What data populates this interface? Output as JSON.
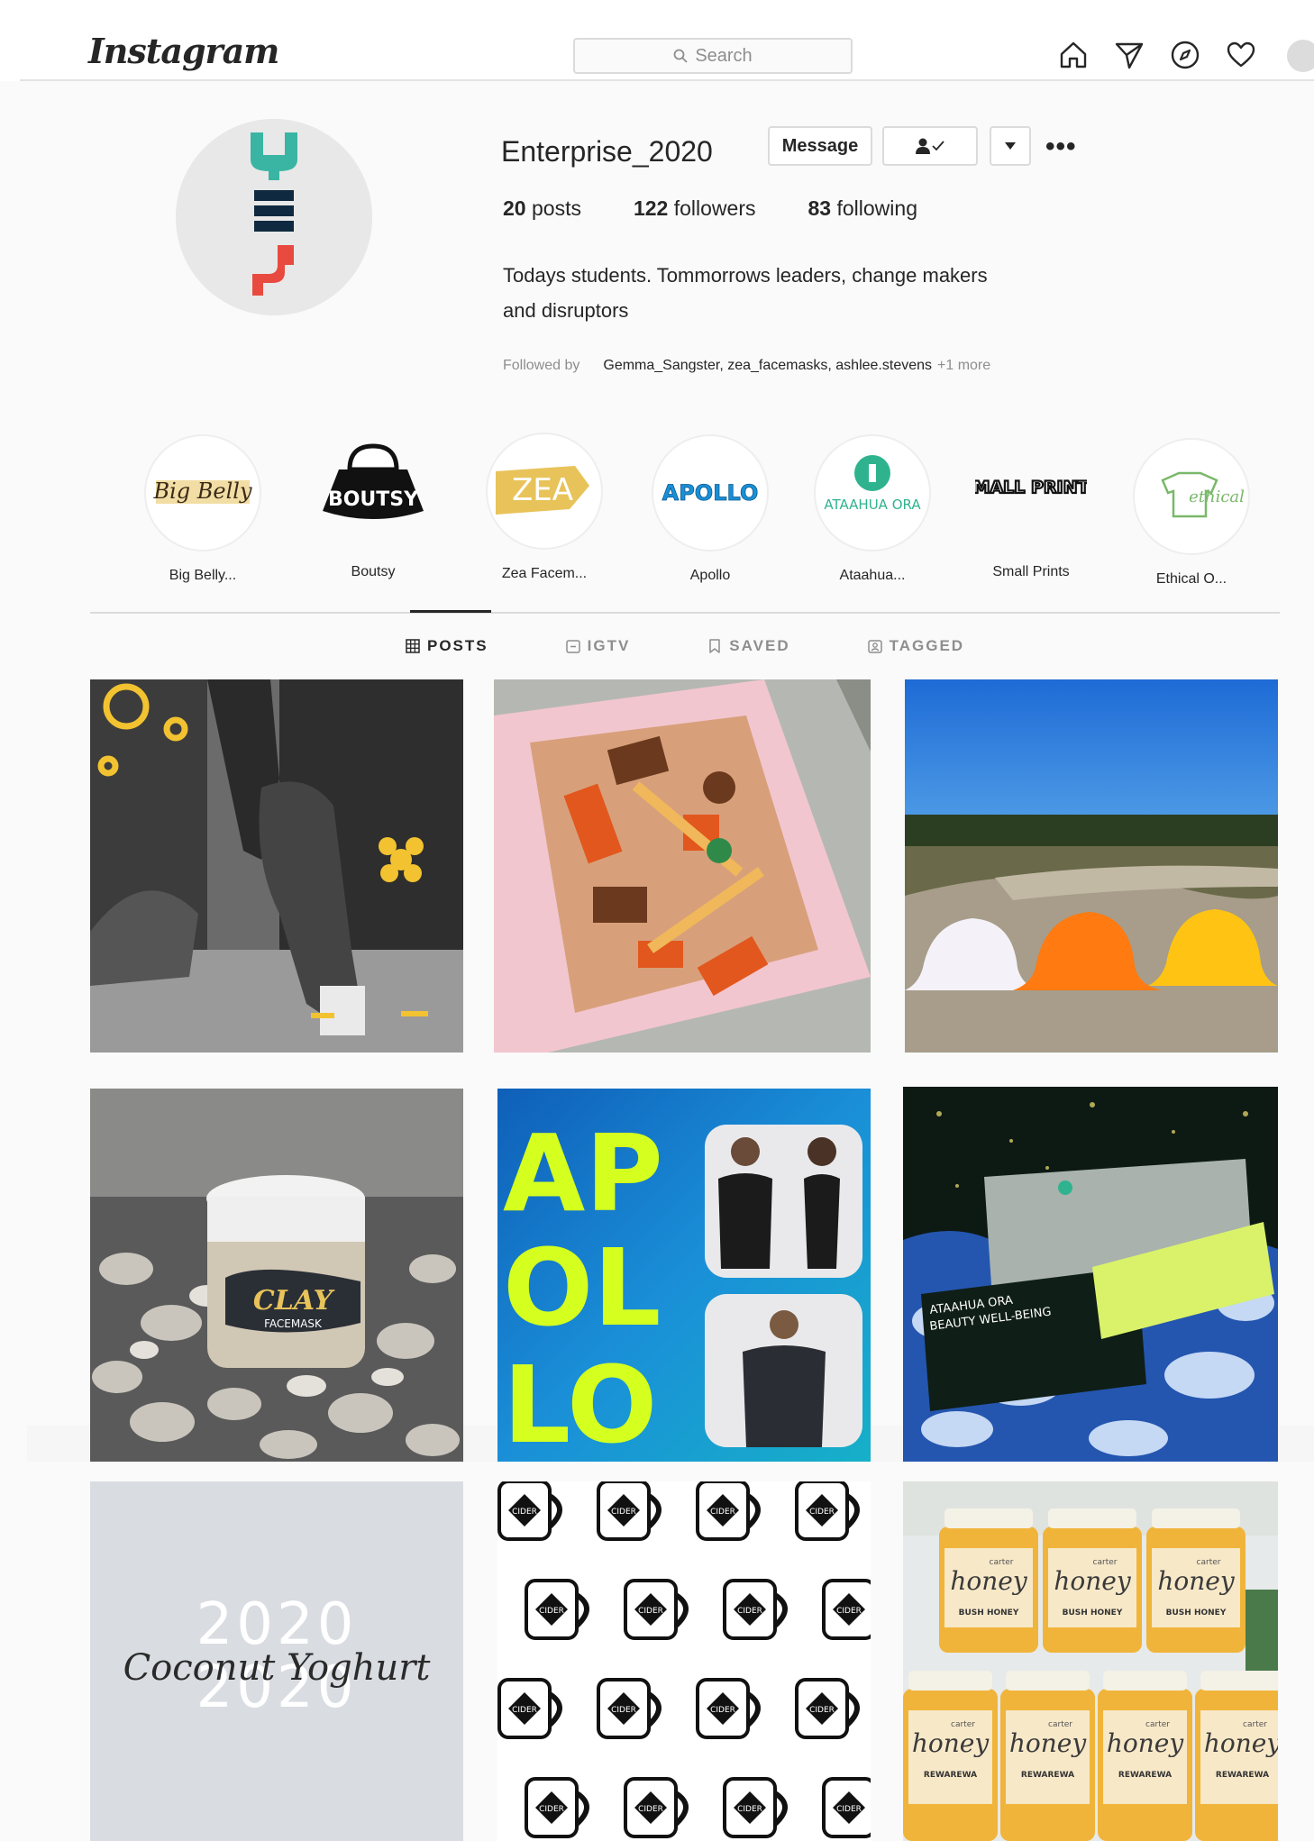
{
  "nav": {
    "logo": "Instagram",
    "search_placeholder": "Search",
    "icons": [
      "home-icon",
      "direct-icon",
      "explore-icon",
      "activity-heart-icon",
      "profile-avatar"
    ]
  },
  "profile": {
    "username": "Enterprise_2020",
    "message_label": "Message",
    "follow_status_icon": "user-check-icon",
    "dropdown_icon": "caret-down-icon",
    "more_label": "•••",
    "posts_count": "20",
    "posts_label": "posts",
    "followers_count": "122",
    "followers_label": "followers",
    "following_count": "83",
    "following_label": "following",
    "bio_line1": "Todays students. Tommorrows leaders, change makers",
    "bio_line2": "and disruptors",
    "followed_by_label": "Followed by",
    "followed_by_names": "Gemma_Sangster, zea_facemasks, ashlee.stevens",
    "followed_by_more": "+1 more"
  },
  "highlights": [
    {
      "label": "Big Belly...",
      "logo_text": "Big Belly"
    },
    {
      "label": "Boutsy",
      "logo_text": "BOUTSY"
    },
    {
      "label": "Zea Facem...",
      "logo_text": "ZEA"
    },
    {
      "label": "Apollo",
      "logo_text": "APOLLO"
    },
    {
      "label": "Ataahua...",
      "logo_text": "ATAAHUA ORA"
    },
    {
      "label": "Small Prints",
      "logo_text": "SMALL PRINTS"
    },
    {
      "label": "Ethical O...",
      "logo_text": "ethical"
    }
  ],
  "tabs": [
    {
      "label": "POSTS",
      "icon": "grid-icon",
      "active": true
    },
    {
      "label": "IGTV",
      "icon": "igtv-icon",
      "active": false
    },
    {
      "label": "SAVED",
      "icon": "bookmark-icon",
      "active": false
    },
    {
      "label": "TAGGED",
      "icon": "tagged-icon",
      "active": false
    }
  ],
  "posts": {
    "p4_text1": "CLAY",
    "p4_text2": "FACEMASK",
    "p5_text1": "AP",
    "p5_text2": "OL",
    "p5_text3": "LO",
    "p6_text1": "ATAAHUA ORA",
    "p6_text2": "BEAUTY WELL-BEING",
    "p7_text": "Coconut Yoghurt",
    "p7_bg_text1": "2020",
    "p7_bg_text2": "2020",
    "p8_text": "CIDER",
    "p9_brand": "honey",
    "p9_top": "carter",
    "p9_label1": "BUSH HONEY",
    "p9_label2": "REWAREWA"
  },
  "colors": {
    "accent": "#262626",
    "muted": "#8e8e8e",
    "border": "#dbdbdb",
    "apollo_lime": "#d4ff1f",
    "apollo_blue": "#1a8fd8"
  }
}
